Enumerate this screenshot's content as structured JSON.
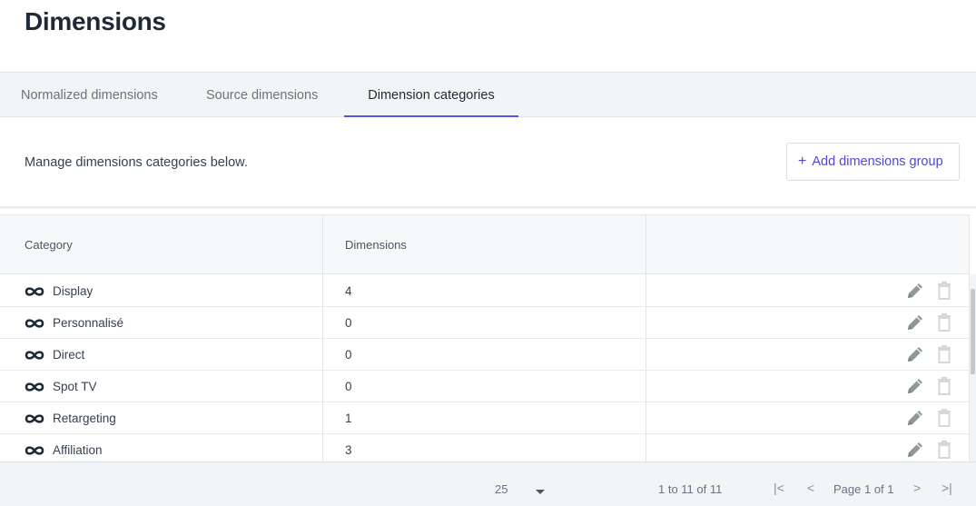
{
  "page": {
    "title": "Dimensions"
  },
  "tabs": [
    {
      "label": "Normalized dimensions"
    },
    {
      "label": "Source dimensions"
    },
    {
      "label": "Dimension categories"
    }
  ],
  "toolbar": {
    "description": "Manage dimensions categories below.",
    "add_button_icon": "+",
    "add_button_label": "Add dimensions group"
  },
  "table": {
    "columns": [
      {
        "label": "Category"
      },
      {
        "label": "Dimensions"
      },
      {
        "label": ""
      }
    ],
    "rows": [
      {
        "category": "Display",
        "dimensions": "4"
      },
      {
        "category": "Personnalisé",
        "dimensions": "0"
      },
      {
        "category": "Direct",
        "dimensions": "0"
      },
      {
        "category": "Spot TV",
        "dimensions": "0"
      },
      {
        "category": "Retargeting",
        "dimensions": "1"
      },
      {
        "category": "Affiliation",
        "dimensions": "3"
      }
    ],
    "row_icon": "infinity-icon",
    "row_action_icons": [
      "pencil-icon",
      "trash-icon"
    ]
  },
  "pagination": {
    "page_size": "25",
    "range_text": "1 to 11 of 11",
    "page_text": "Page 1 of 1",
    "first_icon": "|<",
    "prev_icon": "<",
    "next_icon": ">",
    "last_icon": ">|"
  },
  "colors": {
    "accent": "#5a52e0",
    "add_button_text": "#4f46d8",
    "icon_gray": "#8f9a94"
  }
}
